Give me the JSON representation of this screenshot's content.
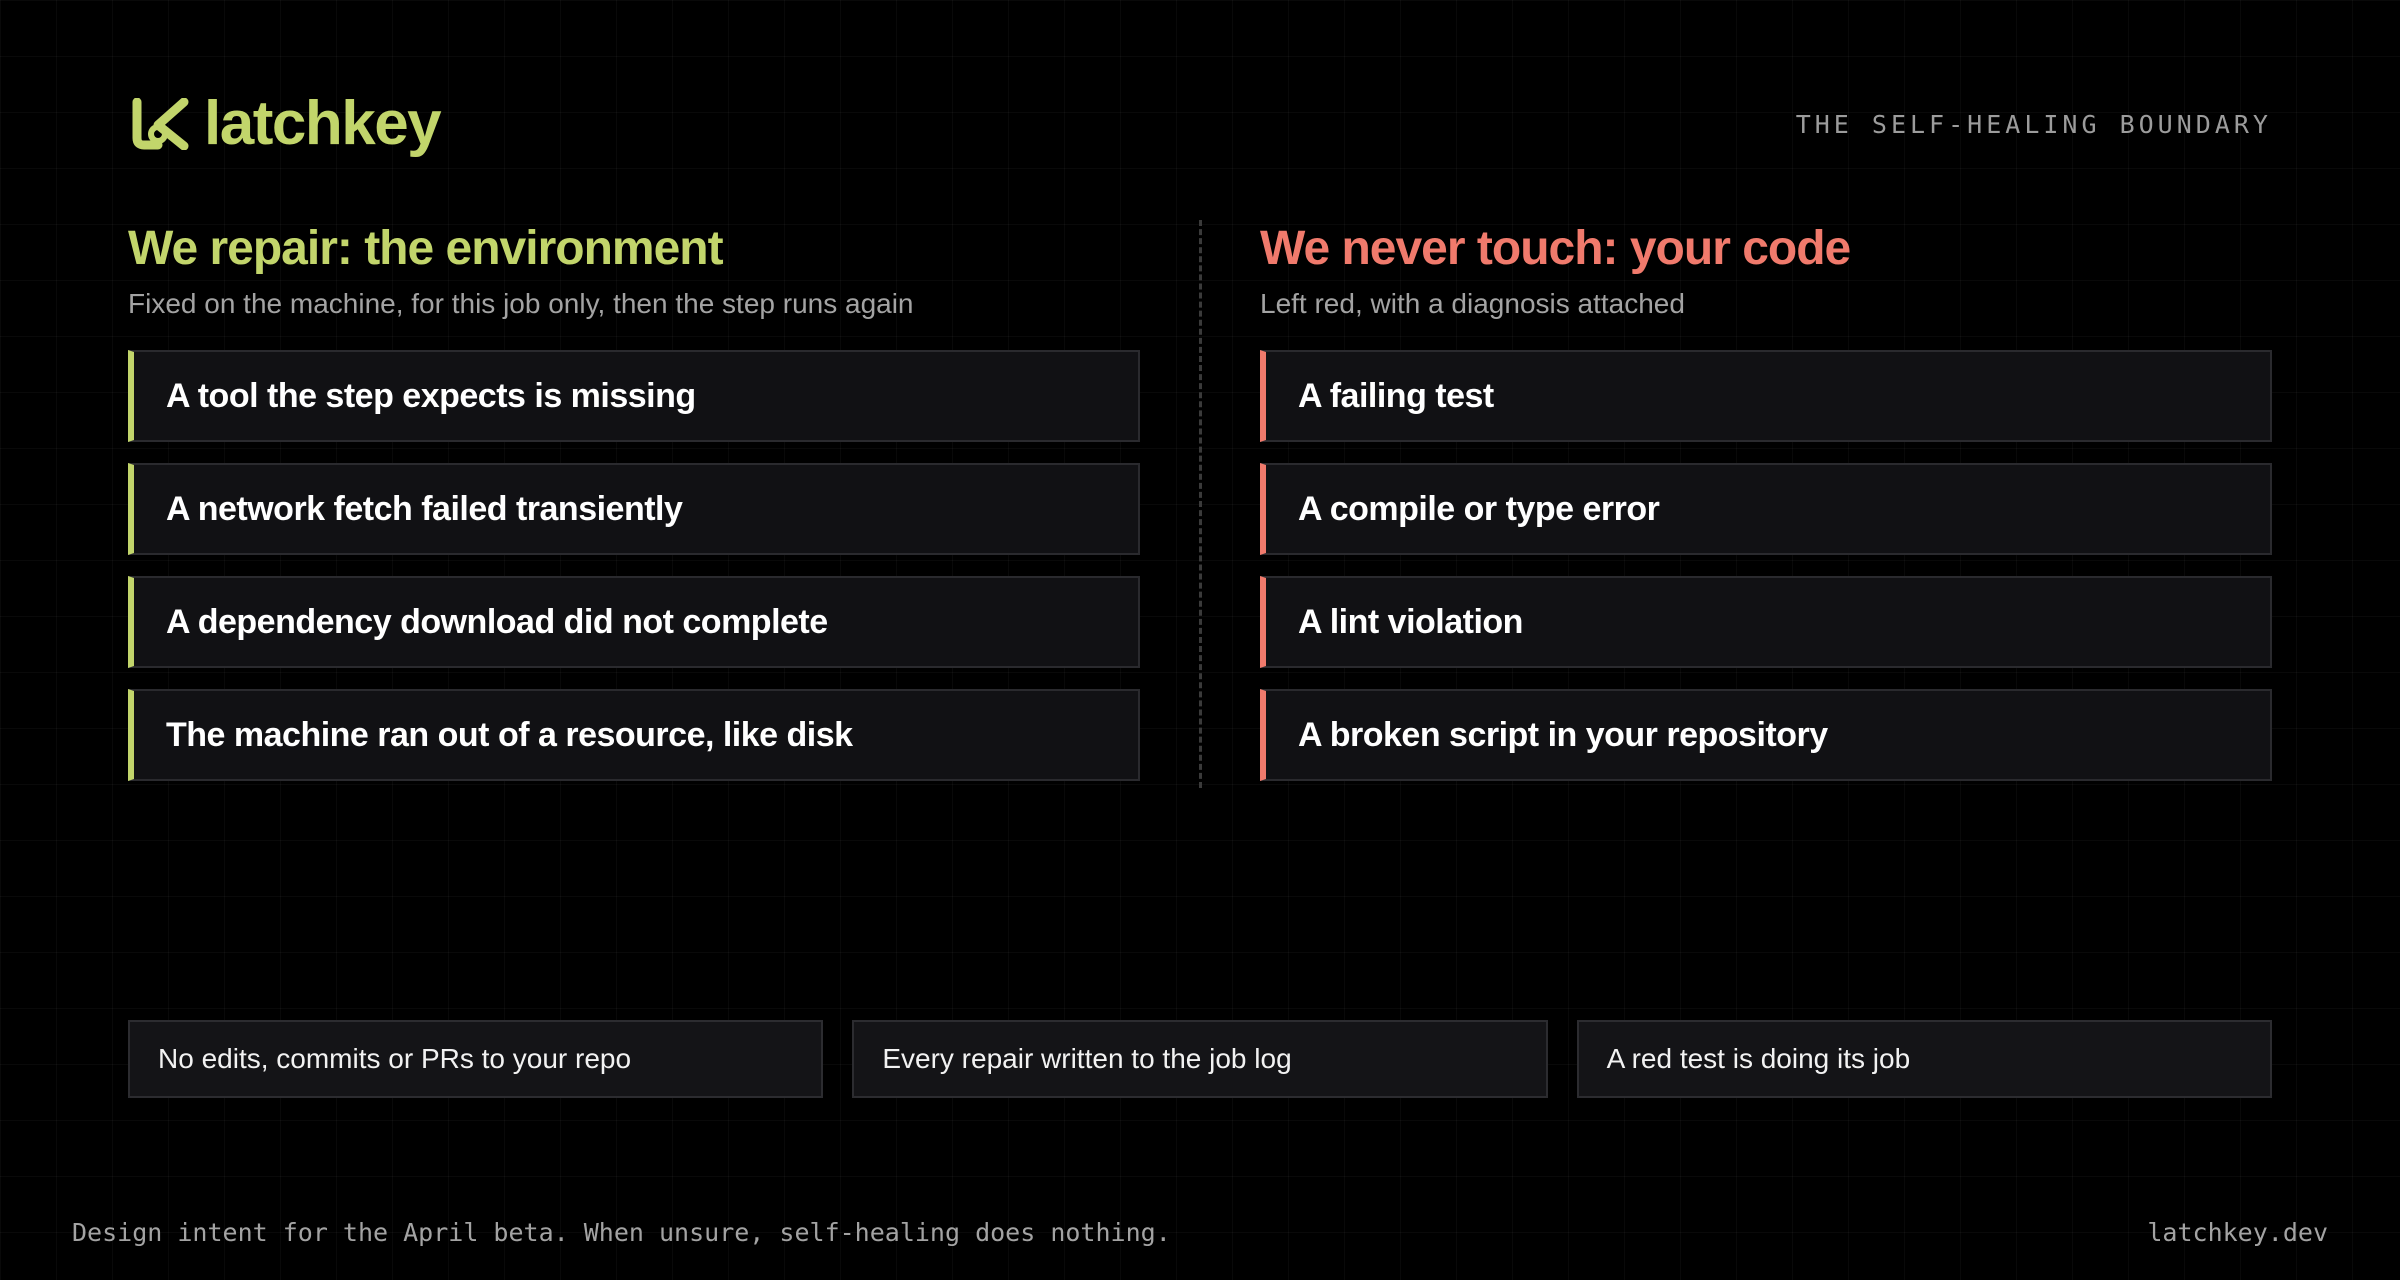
{
  "brand": {
    "name": "latchkey",
    "accent": "#c2d56b",
    "logo_icon": "latchkey-logo-icon"
  },
  "header": {
    "tagline": "THE SELF-HEALING BOUNDARY"
  },
  "repair": {
    "title": "We repair: the environment",
    "subtitle": "Fixed on the machine, for this job only, then the step runs again",
    "color": "#c2d56b",
    "items": [
      "A tool the step expects is missing",
      "A network fetch failed transiently",
      "A dependency download did not complete",
      "The machine ran out of a resource, like disk"
    ]
  },
  "never": {
    "title": "We never touch: your code",
    "subtitle": "Left red, with a diagnosis attached",
    "color": "#f07a6c",
    "items": [
      "A failing test",
      "A compile or type error",
      "A lint violation",
      "A broken script in your repository"
    ]
  },
  "notes": [
    "No edits, commits or PRs to your repo",
    "Every repair written to the job log",
    "A red test is doing its job"
  ],
  "footer": {
    "intent": "Design intent for the April beta. When unsure, self-healing does nothing.",
    "site": "latchkey.dev"
  }
}
